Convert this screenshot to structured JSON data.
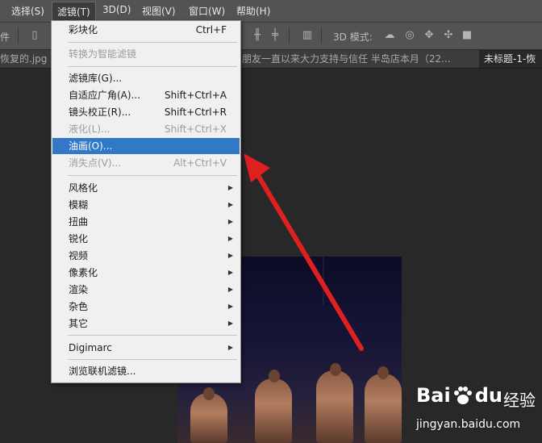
{
  "menubar": {
    "items": [
      "选择(S)",
      "滤镜(T)",
      "3D(D)",
      "视图(V)",
      "窗口(W)",
      "帮助(H)"
    ],
    "active_index": 1
  },
  "options_bar": {
    "left_fragment": "件",
    "mode_label": "3D 模式:"
  },
  "tabs": [
    {
      "label": "恢复的.jpg @"
    },
    {
      "label": "朋友一直以来大力支持与信任 半岛店本月（22..."
    },
    {
      "label": "未标题-1-恢"
    }
  ],
  "filter_menu": {
    "items": [
      {
        "label": "彩块化",
        "shortcut": "Ctrl+F",
        "state": "enabled"
      },
      {
        "label": "转换为智能滤镜",
        "shortcut": "",
        "state": "disabled"
      },
      {
        "label": "滤镜库(G)...",
        "shortcut": "",
        "state": "enabled"
      },
      {
        "label": "自适应广角(A)...",
        "shortcut": "Shift+Ctrl+A",
        "state": "enabled"
      },
      {
        "label": "镜头校正(R)...",
        "shortcut": "Shift+Ctrl+R",
        "state": "enabled"
      },
      {
        "label": "液化(L)...",
        "shortcut": "Shift+Ctrl+X",
        "state": "disabled"
      },
      {
        "label": "油画(O)...",
        "shortcut": "",
        "state": "highlighted"
      },
      {
        "label": "消失点(V)...",
        "shortcut": "Alt+Ctrl+V",
        "state": "disabled"
      },
      {
        "label": "风格化",
        "submenu": true
      },
      {
        "label": "模糊",
        "submenu": true
      },
      {
        "label": "扭曲",
        "submenu": true
      },
      {
        "label": "锐化",
        "submenu": true
      },
      {
        "label": "视频",
        "submenu": true
      },
      {
        "label": "像素化",
        "submenu": true
      },
      {
        "label": "渲染",
        "submenu": true
      },
      {
        "label": "杂色",
        "submenu": true
      },
      {
        "label": "其它",
        "submenu": true
      },
      {
        "label": "Digimarc",
        "submenu": true
      },
      {
        "label": "浏览联机滤镜...",
        "shortcut": "",
        "state": "enabled"
      }
    ]
  },
  "watermark": {
    "brand": "Bai",
    "brand_suffix": "du",
    "jingyan": "经验",
    "url": "jingyan.baidu.com"
  },
  "colors": {
    "highlight": "#3178c6",
    "annotation_arrow": "#e02020"
  },
  "icons": {
    "submenu_arrow": "right-triangle",
    "annotation": "red-arrow"
  }
}
